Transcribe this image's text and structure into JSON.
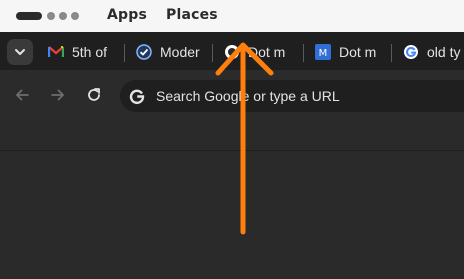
{
  "topbar": {
    "apps_label": "Apps",
    "places_label": "Places"
  },
  "tabs": [
    {
      "title": "5th of",
      "icon": "gmail-icon"
    },
    {
      "title": "Moder",
      "icon": "modern-site-icon"
    },
    {
      "title": "Dot m",
      "icon": "chrome-icon"
    },
    {
      "title": "Dot m",
      "icon": "dot-m-icon"
    },
    {
      "title": "old ty",
      "icon": "google-icon"
    }
  ],
  "toolbar": {
    "omnibox_placeholder": "Search Google or type a URL"
  },
  "colors": {
    "annotation_arrow": "#ff7f0e",
    "topbar_bg": "#f6f6f6",
    "chrome_bg": "#1f1f1f"
  }
}
